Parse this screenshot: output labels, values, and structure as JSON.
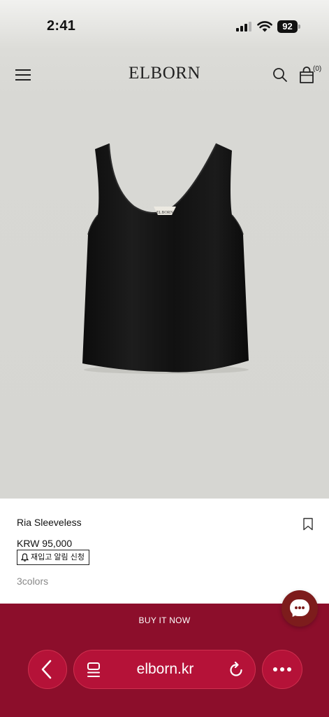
{
  "status_bar": {
    "time": "2:41",
    "battery": "92"
  },
  "header": {
    "logo": "ELBORN",
    "cart_count": "(0)"
  },
  "product": {
    "name": "Ria Sleeveless",
    "price": "KRW 95,000",
    "restock_label": "재입고 알림 신청",
    "colors": "3colors",
    "label_tag": "ELBORN"
  },
  "actions": {
    "buy_now": "BUY IT NOW"
  },
  "browser": {
    "url": "elborn.kr"
  },
  "colors": {
    "accent": "#8c0e2b",
    "pill": "#b51238",
    "chat": "#7d1c1c"
  }
}
